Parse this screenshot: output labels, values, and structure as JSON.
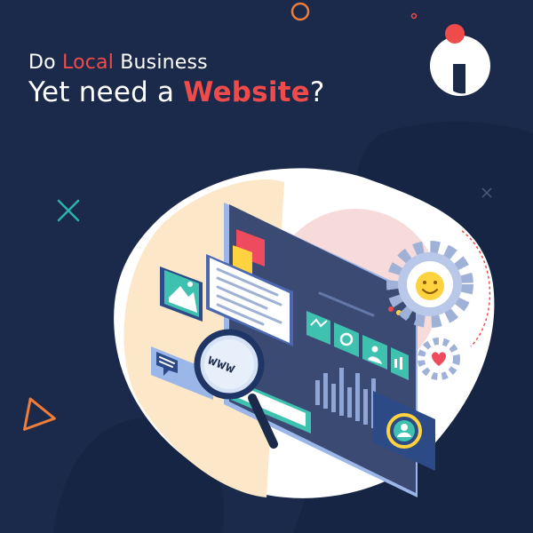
{
  "headline": {
    "line1": {
      "before": "Do ",
      "highlight": "Local",
      "after": " Business"
    },
    "line2": {
      "before": "Yet need a ",
      "highlight": "Website",
      "after": "?"
    }
  },
  "illustration": {
    "search_label": "www"
  },
  "colors": {
    "background": "#1b2a4a",
    "accent": "#ef4b4b",
    "text": "#ffffff",
    "blob": "#ffffff",
    "peach": "#fde7c9",
    "pink": "#f6d6d6",
    "screen": "#3a4a73",
    "panel_blue": "#2c4a86",
    "teal": "#3fc1b0",
    "yellow": "#ffd23f"
  },
  "icons": [
    "logo-icon",
    "image-icon",
    "chat-icon",
    "magnifier-icon",
    "gear-icon",
    "smiley-icon",
    "user-icon",
    "heart-icon",
    "triangle-icon",
    "cross-icon",
    "ring-icon"
  ]
}
